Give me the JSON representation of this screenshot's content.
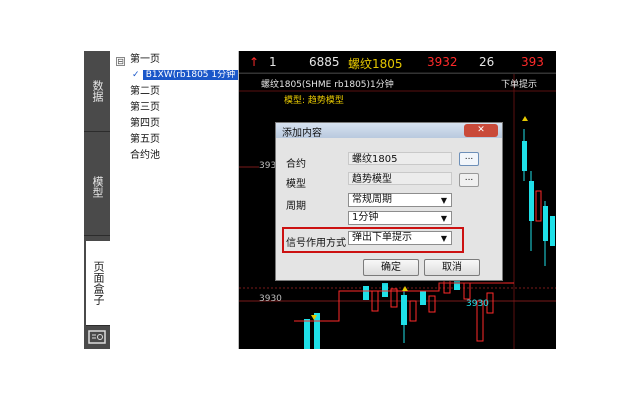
{
  "sidebar": {
    "tabs": [
      {
        "label": "数据"
      },
      {
        "label": "模型"
      },
      {
        "label": "页面盒子"
      }
    ]
  },
  "tree": {
    "items": [
      {
        "label": "第一页",
        "toggle": "⊟"
      },
      {
        "label": "B1XW(rb1805 1分钟"
      },
      {
        "label": "第二页"
      },
      {
        "label": "第三页"
      },
      {
        "label": "第四页"
      },
      {
        "label": "第五页"
      },
      {
        "label": "合约池"
      }
    ]
  },
  "quote": {
    "arrow": "↑",
    "v1": "1",
    "v2": "6885",
    "name": "螺纹1805",
    "v3": "3932",
    "v4": "26",
    "v5": "393"
  },
  "chart": {
    "header": "螺纹1805(SHME rb1805)1分钟",
    "order_hint": "下单提示",
    "model_label": "模型: 趋势模型",
    "price_labels": [
      "3930",
      "3930",
      "3930"
    ],
    "colors": {
      "up": "#ff2a2a",
      "down": "#1fe0e8",
      "signal": "#e6c800"
    }
  },
  "dialog": {
    "title": "添加内容",
    "close": "✕",
    "contract_label": "合约",
    "contract_value": "螺纹1805",
    "model_label": "模型",
    "model_value": "趋势模型",
    "period_label": "周期",
    "period_value": "常规周期",
    "period_sub_value": "1分钟",
    "signal_label": "信号作用方式",
    "signal_value": "弹出下单提示",
    "browse": "...",
    "ok": "确定",
    "cancel": "取消"
  }
}
